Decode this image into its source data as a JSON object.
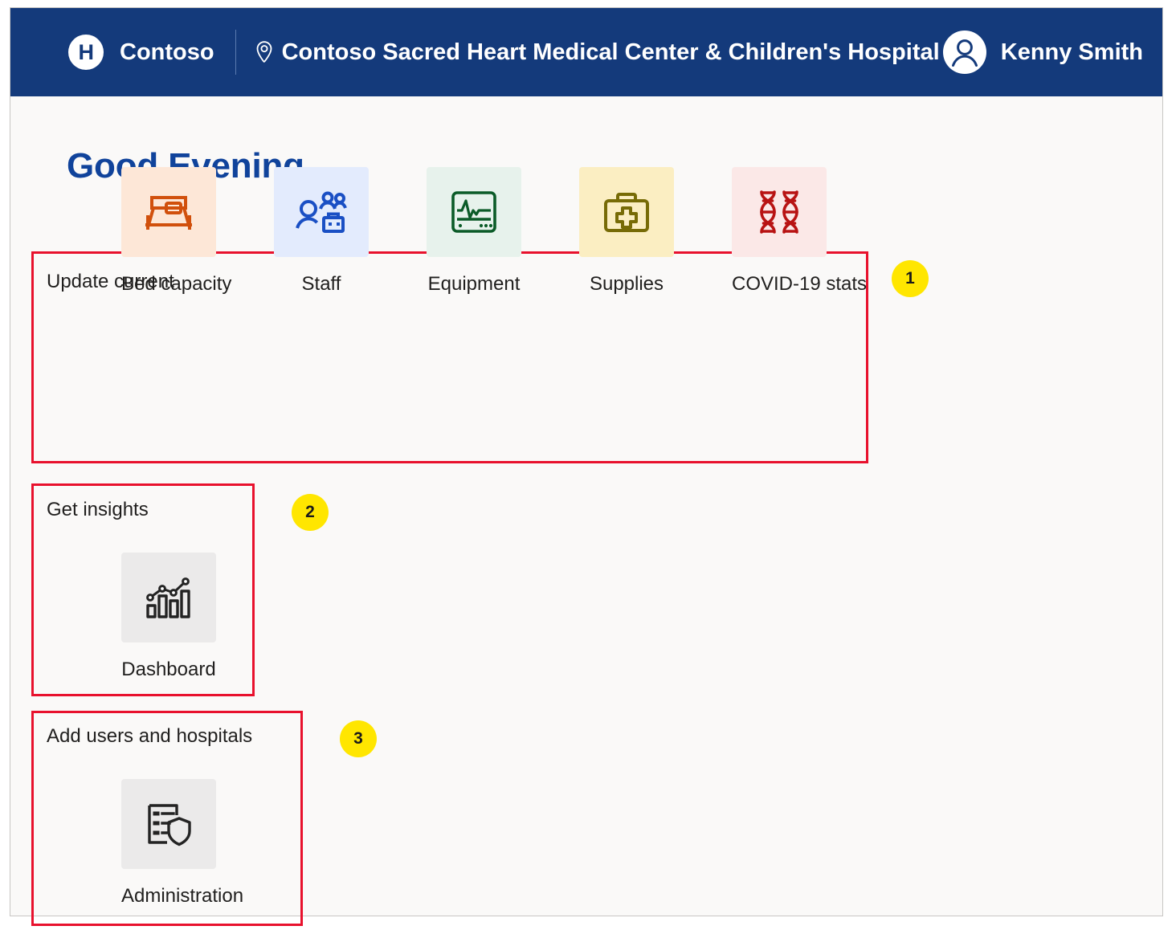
{
  "header": {
    "logo_letter": "H",
    "logo_icon": "hospital-h-logo",
    "brand": "Contoso",
    "location_icon": "map-pin-icon",
    "facility": "Contoso Sacred Heart Medical Center & Children's Hospital",
    "avatar_icon": "user-avatar-icon",
    "user": "Kenny Smith"
  },
  "page": {
    "greeting": "Good Evening"
  },
  "sections": [
    {
      "title": "Update current",
      "badge": "1",
      "tiles": [
        {
          "label": "Bed capacity",
          "icon": "bed-icon",
          "tile_bg": "#fde7d7",
          "icon_color": "#d1500c"
        },
        {
          "label": "Staff",
          "icon": "staff-group-icon",
          "tile_bg": "#e3ebfd",
          "icon_color": "#1a4fc4"
        },
        {
          "label": "Equipment",
          "icon": "vitals-monitor-icon",
          "tile_bg": "#e7f2ec",
          "icon_color": "#0b5b28"
        },
        {
          "label": "Supplies",
          "icon": "first-aid-kit-icon",
          "tile_bg": "#fbeec2",
          "icon_color": "#776b06"
        },
        {
          "label": "COVID-19 stats",
          "icon": "dna-helix-icon",
          "tile_bg": "#fbe8e7",
          "icon_color": "#b81313"
        }
      ]
    },
    {
      "title": "Get insights",
      "badge": "2",
      "tiles": [
        {
          "label": "Dashboard",
          "icon": "bar-chart-trend-icon",
          "tile_bg": "#ebeaea",
          "icon_color": "#232323"
        }
      ]
    },
    {
      "title": "Add users and hospitals",
      "badge": "3",
      "tiles": [
        {
          "label": "Administration",
          "icon": "checklist-shield-icon",
          "tile_bg": "#ebeaea",
          "icon_color": "#232323"
        }
      ]
    }
  ],
  "colors": {
    "header_blue": "#143a7b",
    "greeting_blue": "#10439b",
    "annotation_red": "#e8112d",
    "badge_yellow": "#ffe600",
    "page_bg": "#faf9f8"
  }
}
